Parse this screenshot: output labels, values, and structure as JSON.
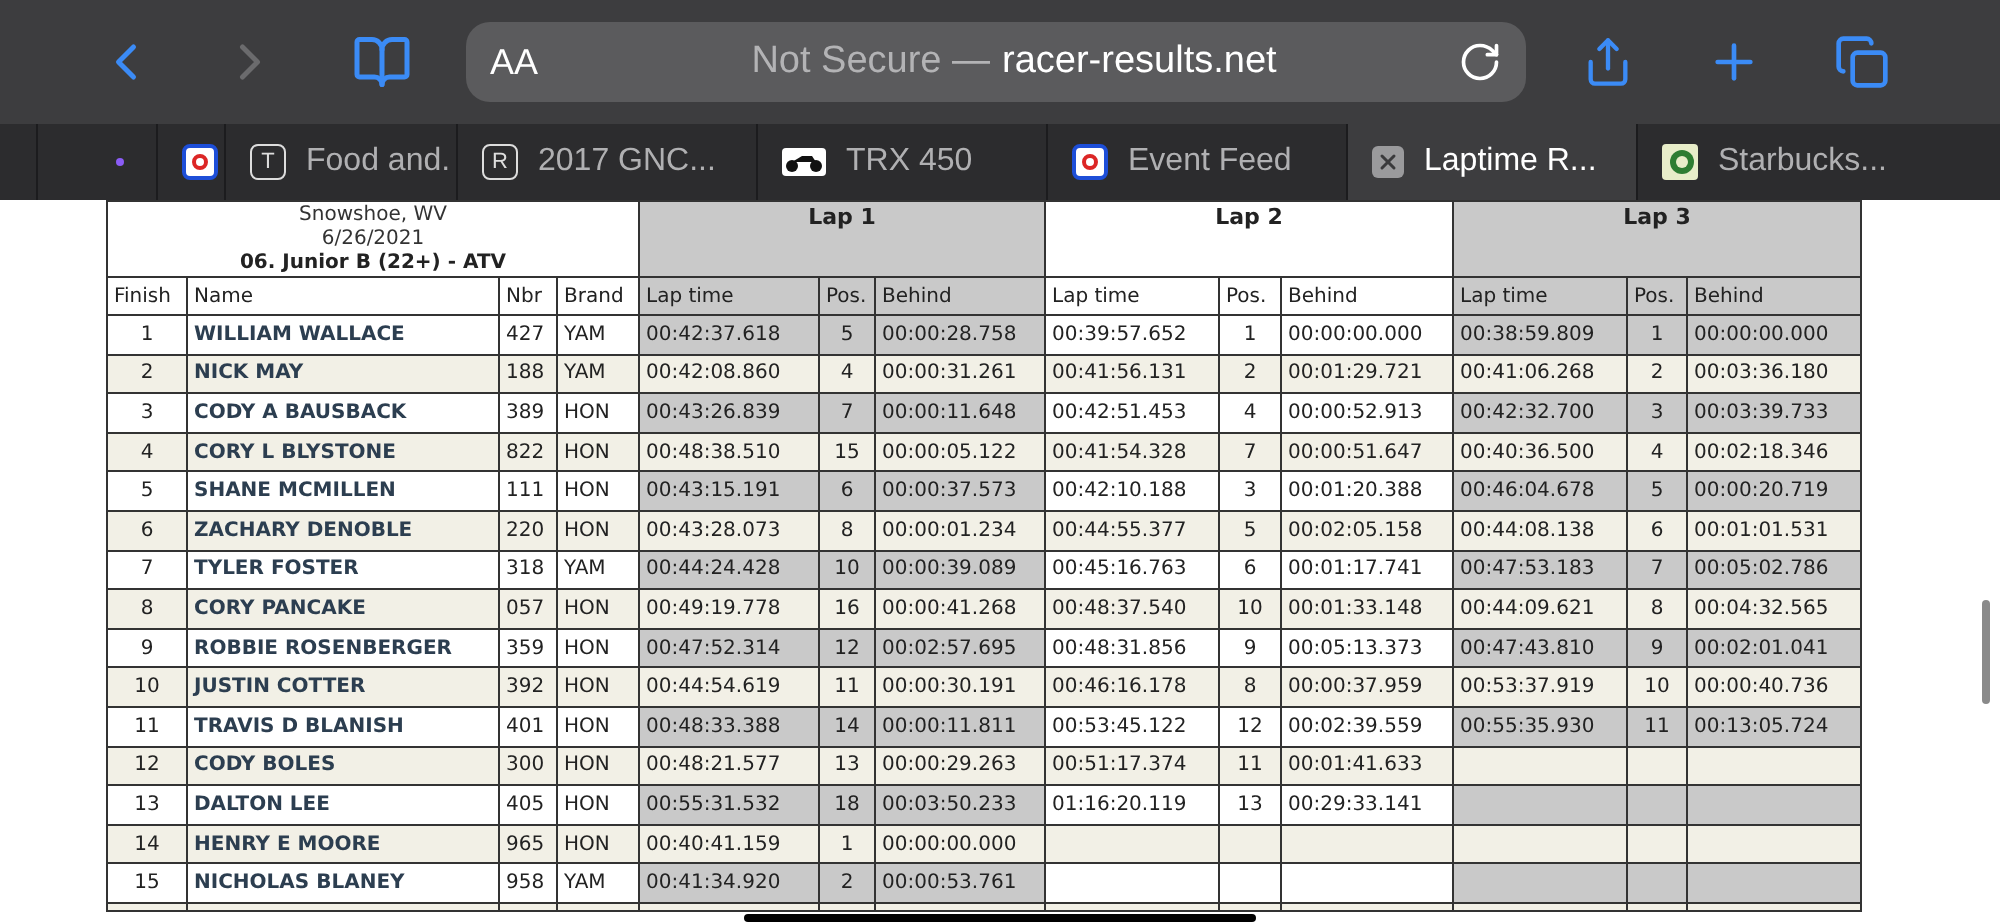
{
  "toolbar": {
    "aa": "AA",
    "security": "Not Secure —",
    "host": "racer-results.net"
  },
  "tabs": [
    {
      "kind": "partial",
      "selected": false
    },
    {
      "kind": "logo",
      "selected": false
    },
    {
      "kind": "letter",
      "letter": "T",
      "label": "Food and.",
      "selected": false
    },
    {
      "kind": "letter",
      "letter": "R",
      "label": "2017 GNC...",
      "selected": false
    },
    {
      "kind": "bike",
      "label": "TRX 450",
      "selected": false
    },
    {
      "kind": "logo",
      "label": "Event Feed",
      "selected": false
    },
    {
      "kind": "close",
      "label": "Laptime R...",
      "selected": true
    },
    {
      "kind": "cup",
      "label": "Starbucks...",
      "selected": false
    }
  ],
  "event": {
    "location": "Snowshoe, WV",
    "date": "6/26/2021",
    "class": "06. Junior B (22+) - ATV"
  },
  "columns": [
    "Finish",
    "Name",
    "Nbr",
    "Brand"
  ],
  "laps": [
    {
      "title": "Lap 1",
      "columns": [
        "Lap time",
        "Pos.",
        "Behind"
      ]
    },
    {
      "title": "Lap 2",
      "columns": [
        "Lap time",
        "Pos.",
        "Behind"
      ]
    },
    {
      "title": "Lap 3",
      "columns": [
        "Lap time",
        "Pos.",
        "Behind"
      ]
    }
  ],
  "rows": [
    {
      "finish": "1",
      "name": "WILLIAM WALLACE",
      "nbr": "427",
      "brand": "YAM",
      "laps": [
        [
          "00:42:37.618",
          "5",
          "00:00:28.758"
        ],
        [
          "00:39:57.652",
          "1",
          "00:00:00.000"
        ],
        [
          "00:38:59.809",
          "1",
          "00:00:00.000"
        ]
      ]
    },
    {
      "finish": "2",
      "name": "NICK MAY",
      "nbr": "188",
      "brand": "YAM",
      "laps": [
        [
          "00:42:08.860",
          "4",
          "00:00:31.261"
        ],
        [
          "00:41:56.131",
          "2",
          "00:01:29.721"
        ],
        [
          "00:41:06.268",
          "2",
          "00:03:36.180"
        ]
      ]
    },
    {
      "finish": "3",
      "name": "CODY A BAUSBACK",
      "nbr": "389",
      "brand": "HON",
      "laps": [
        [
          "00:43:26.839",
          "7",
          "00:00:11.648"
        ],
        [
          "00:42:51.453",
          "4",
          "00:00:52.913"
        ],
        [
          "00:42:32.700",
          "3",
          "00:03:39.733"
        ]
      ]
    },
    {
      "finish": "4",
      "name": "CORY L BLYSTONE",
      "nbr": "822",
      "brand": "HON",
      "laps": [
        [
          "00:48:38.510",
          "15",
          "00:00:05.122"
        ],
        [
          "00:41:54.328",
          "7",
          "00:00:51.647"
        ],
        [
          "00:40:36.500",
          "4",
          "00:02:18.346"
        ]
      ]
    },
    {
      "finish": "5",
      "name": "SHANE MCMILLEN",
      "nbr": "111",
      "brand": "HON",
      "laps": [
        [
          "00:43:15.191",
          "6",
          "00:00:37.573"
        ],
        [
          "00:42:10.188",
          "3",
          "00:01:20.388"
        ],
        [
          "00:46:04.678",
          "5",
          "00:00:20.719"
        ]
      ]
    },
    {
      "finish": "6",
      "name": "ZACHARY DENOBLE",
      "nbr": "220",
      "brand": "HON",
      "laps": [
        [
          "00:43:28.073",
          "8",
          "00:00:01.234"
        ],
        [
          "00:44:55.377",
          "5",
          "00:02:05.158"
        ],
        [
          "00:44:08.138",
          "6",
          "00:01:01.531"
        ]
      ]
    },
    {
      "finish": "7",
      "name": "TYLER FOSTER",
      "nbr": "318",
      "brand": "YAM",
      "laps": [
        [
          "00:44:24.428",
          "10",
          "00:00:39.089"
        ],
        [
          "00:45:16.763",
          "6",
          "00:01:17.741"
        ],
        [
          "00:47:53.183",
          "7",
          "00:05:02.786"
        ]
      ]
    },
    {
      "finish": "8",
      "name": "CORY PANCAKE",
      "nbr": "057",
      "brand": "HON",
      "laps": [
        [
          "00:49:19.778",
          "16",
          "00:00:41.268"
        ],
        [
          "00:48:37.540",
          "10",
          "00:01:33.148"
        ],
        [
          "00:44:09.621",
          "8",
          "00:04:32.565"
        ]
      ]
    },
    {
      "finish": "9",
      "name": "ROBBIE ROSENBERGER",
      "nbr": "359",
      "brand": "HON",
      "laps": [
        [
          "00:47:52.314",
          "12",
          "00:02:57.695"
        ],
        [
          "00:48:31.856",
          "9",
          "00:05:13.373"
        ],
        [
          "00:47:43.810",
          "9",
          "00:02:01.041"
        ]
      ]
    },
    {
      "finish": "10",
      "name": "JUSTIN COTTER",
      "nbr": "392",
      "brand": "HON",
      "laps": [
        [
          "00:44:54.619",
          "11",
          "00:00:30.191"
        ],
        [
          "00:46:16.178",
          "8",
          "00:00:37.959"
        ],
        [
          "00:53:37.919",
          "10",
          "00:00:40.736"
        ]
      ]
    },
    {
      "finish": "11",
      "name": "TRAVIS D BLANISH",
      "nbr": "401",
      "brand": "HON",
      "laps": [
        [
          "00:48:33.388",
          "14",
          "00:00:11.811"
        ],
        [
          "00:53:45.122",
          "12",
          "00:02:39.559"
        ],
        [
          "00:55:35.930",
          "11",
          "00:13:05.724"
        ]
      ]
    },
    {
      "finish": "12",
      "name": "CODY BOLES",
      "nbr": "300",
      "brand": "HON",
      "laps": [
        [
          "00:48:21.577",
          "13",
          "00:00:29.263"
        ],
        [
          "00:51:17.374",
          "11",
          "00:01:41.633"
        ]
      ]
    },
    {
      "finish": "13",
      "name": "DALTON LEE",
      "nbr": "405",
      "brand": "HON",
      "laps": [
        [
          "00:55:31.532",
          "18",
          "00:03:50.233"
        ],
        [
          "01:16:20.119",
          "13",
          "00:29:33.141"
        ]
      ]
    },
    {
      "finish": "14",
      "name": "HENRY E MOORE",
      "nbr": "965",
      "brand": "HON",
      "laps": [
        [
          "00:40:41.159",
          "1",
          "00:00:00.000"
        ]
      ]
    },
    {
      "finish": "15",
      "name": "NICHOLAS BLANEY",
      "nbr": "958",
      "brand": "YAM",
      "laps": [
        [
          "00:41:34.920",
          "2",
          "00:00:53.761"
        ]
      ]
    }
  ]
}
